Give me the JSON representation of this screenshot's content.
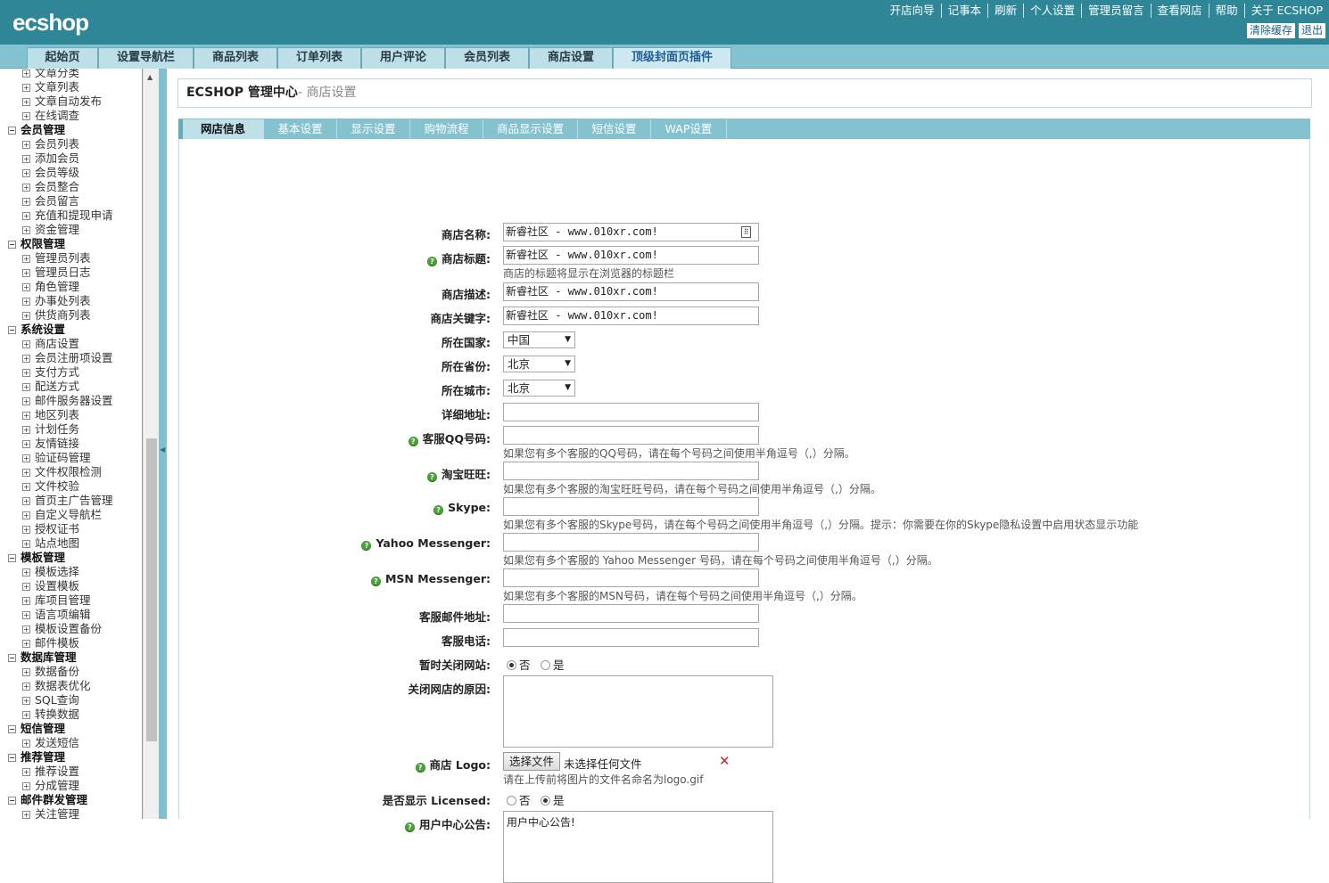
{
  "header": {
    "logo": "ecshop",
    "links": [
      "开店向导",
      "记事本",
      "刷新",
      "个人设置",
      "管理员留言",
      "查看网店",
      "帮助",
      "关于 ECSHOP"
    ],
    "clear_cache": "清除缓存",
    "logout": "退出"
  },
  "menu": [
    "起始页",
    "设置导航栏",
    "商品列表",
    "订单列表",
    "用户评论",
    "会员列表",
    "商店设置",
    "顶级封面页插件"
  ],
  "sidebar": [
    {
      "type": "sub",
      "label": "文章分类"
    },
    {
      "type": "sub",
      "label": "文章列表"
    },
    {
      "type": "sub",
      "label": "文章自动发布"
    },
    {
      "type": "sub",
      "label": "在线调查"
    },
    {
      "type": "grp",
      "label": "会员管理"
    },
    {
      "type": "sub",
      "label": "会员列表"
    },
    {
      "type": "sub",
      "label": "添加会员"
    },
    {
      "type": "sub",
      "label": "会员等级"
    },
    {
      "type": "sub",
      "label": "会员整合"
    },
    {
      "type": "sub",
      "label": "会员留言"
    },
    {
      "type": "sub",
      "label": "充值和提现申请"
    },
    {
      "type": "sub",
      "label": "资金管理"
    },
    {
      "type": "grp",
      "label": "权限管理"
    },
    {
      "type": "sub",
      "label": "管理员列表"
    },
    {
      "type": "sub",
      "label": "管理员日志"
    },
    {
      "type": "sub",
      "label": "角色管理"
    },
    {
      "type": "sub",
      "label": "办事处列表"
    },
    {
      "type": "sub",
      "label": "供货商列表"
    },
    {
      "type": "grp",
      "label": "系统设置"
    },
    {
      "type": "sub",
      "label": "商店设置"
    },
    {
      "type": "sub",
      "label": "会员注册项设置"
    },
    {
      "type": "sub",
      "label": "支付方式"
    },
    {
      "type": "sub",
      "label": "配送方式"
    },
    {
      "type": "sub",
      "label": "邮件服务器设置"
    },
    {
      "type": "sub",
      "label": "地区列表"
    },
    {
      "type": "sub",
      "label": "计划任务"
    },
    {
      "type": "sub",
      "label": "友情链接"
    },
    {
      "type": "sub",
      "label": "验证码管理"
    },
    {
      "type": "sub",
      "label": "文件权限检测"
    },
    {
      "type": "sub",
      "label": "文件校验"
    },
    {
      "type": "sub",
      "label": "首页主广告管理"
    },
    {
      "type": "sub",
      "label": "自定义导航栏"
    },
    {
      "type": "sub",
      "label": "授权证书"
    },
    {
      "type": "sub",
      "label": "站点地图"
    },
    {
      "type": "grp",
      "label": "模板管理"
    },
    {
      "type": "sub",
      "label": "模板选择"
    },
    {
      "type": "sub",
      "label": "设置模板"
    },
    {
      "type": "sub",
      "label": "库项目管理"
    },
    {
      "type": "sub",
      "label": "语言项编辑"
    },
    {
      "type": "sub",
      "label": "模板设置备份"
    },
    {
      "type": "sub",
      "label": "邮件模板"
    },
    {
      "type": "grp",
      "label": "数据库管理"
    },
    {
      "type": "sub",
      "label": "数据备份"
    },
    {
      "type": "sub",
      "label": "数据表优化"
    },
    {
      "type": "sub",
      "label": "SQL查询"
    },
    {
      "type": "sub",
      "label": "转换数据"
    },
    {
      "type": "grp",
      "label": "短信管理"
    },
    {
      "type": "sub",
      "label": "发送短信"
    },
    {
      "type": "grp",
      "label": "推荐管理"
    },
    {
      "type": "sub",
      "label": "推荐设置"
    },
    {
      "type": "sub",
      "label": "分成管理"
    },
    {
      "type": "grp",
      "label": "邮件群发管理"
    },
    {
      "type": "sub",
      "label": "关注管理"
    }
  ],
  "page": {
    "title": "ECSHOP 管理中心",
    "subtitle": "- 商店设置"
  },
  "tabs": [
    "网店信息",
    "基本设置",
    "显示设置",
    "购物流程",
    "商品显示设置",
    "短信设置",
    "WAP设置"
  ],
  "form": {
    "shop_name": {
      "label": "商店名称:",
      "value": "新睿社区 - www.010xr.com!"
    },
    "shop_title": {
      "label": "商店标题:",
      "value": "新睿社区 - www.010xr.com!",
      "note": "商店的标题将显示在浏览器的标题栏"
    },
    "shop_desc": {
      "label": "商店描述:",
      "value": "新睿社区 - www.010xr.com!"
    },
    "shop_keywords": {
      "label": "商店关键字:",
      "value": "新睿社区 - www.010xr.com!"
    },
    "country": {
      "label": "所在国家:",
      "value": "中国"
    },
    "province": {
      "label": "所在省份:",
      "value": "北京"
    },
    "city": {
      "label": "所在城市:",
      "value": "北京"
    },
    "address": {
      "label": "详细地址:",
      "value": ""
    },
    "qq": {
      "label": "客服QQ号码:",
      "value": "",
      "note": "如果您有多个客服的QQ号码，请在每个号码之间使用半角逗号（,）分隔。"
    },
    "ww": {
      "label": "淘宝旺旺:",
      "value": "",
      "note": "如果您有多个客服的淘宝旺旺号码，请在每个号码之间使用半角逗号（,）分隔。"
    },
    "skype": {
      "label": "Skype:",
      "value": "",
      "note": "如果您有多个客服的Skype号码，请在每个号码之间使用半角逗号（,）分隔。提示：你需要在你的Skype隐私设置中启用状态显示功能"
    },
    "yahoo": {
      "label": "Yahoo Messenger:",
      "value": "",
      "note": "如果您有多个客服的 Yahoo Messenger 号码，请在每个号码之间使用半角逗号（,）分隔。"
    },
    "msn": {
      "label": "MSN Messenger:",
      "value": "",
      "note": "如果您有多个客服的MSN号码，请在每个号码之间使用半角逗号（,）分隔。"
    },
    "email": {
      "label": "客服邮件地址:",
      "value": ""
    },
    "phone": {
      "label": "客服电话:",
      "value": ""
    },
    "closed": {
      "label": "暂时关闭网站:",
      "no": "否",
      "yes": "是"
    },
    "close_reason": {
      "label": "关闭网店的原因:",
      "value": ""
    },
    "logo": {
      "label": "商店 Logo:",
      "button": "选择文件",
      "status": "未选择任何文件",
      "note": "请在上传前将图片的文件名命名为logo.gif"
    },
    "licensed": {
      "label": "是否显示 Licensed:",
      "no": "否",
      "yes": "是"
    },
    "notice": {
      "label": "用户中心公告:",
      "value": "用户中心公告!"
    }
  },
  "colors": {
    "header": "#2e8697",
    "menu": "#83c2d0",
    "tab_active": "#bde0e9",
    "help_icon": "#4aa33a",
    "delete": "#cc2222"
  }
}
